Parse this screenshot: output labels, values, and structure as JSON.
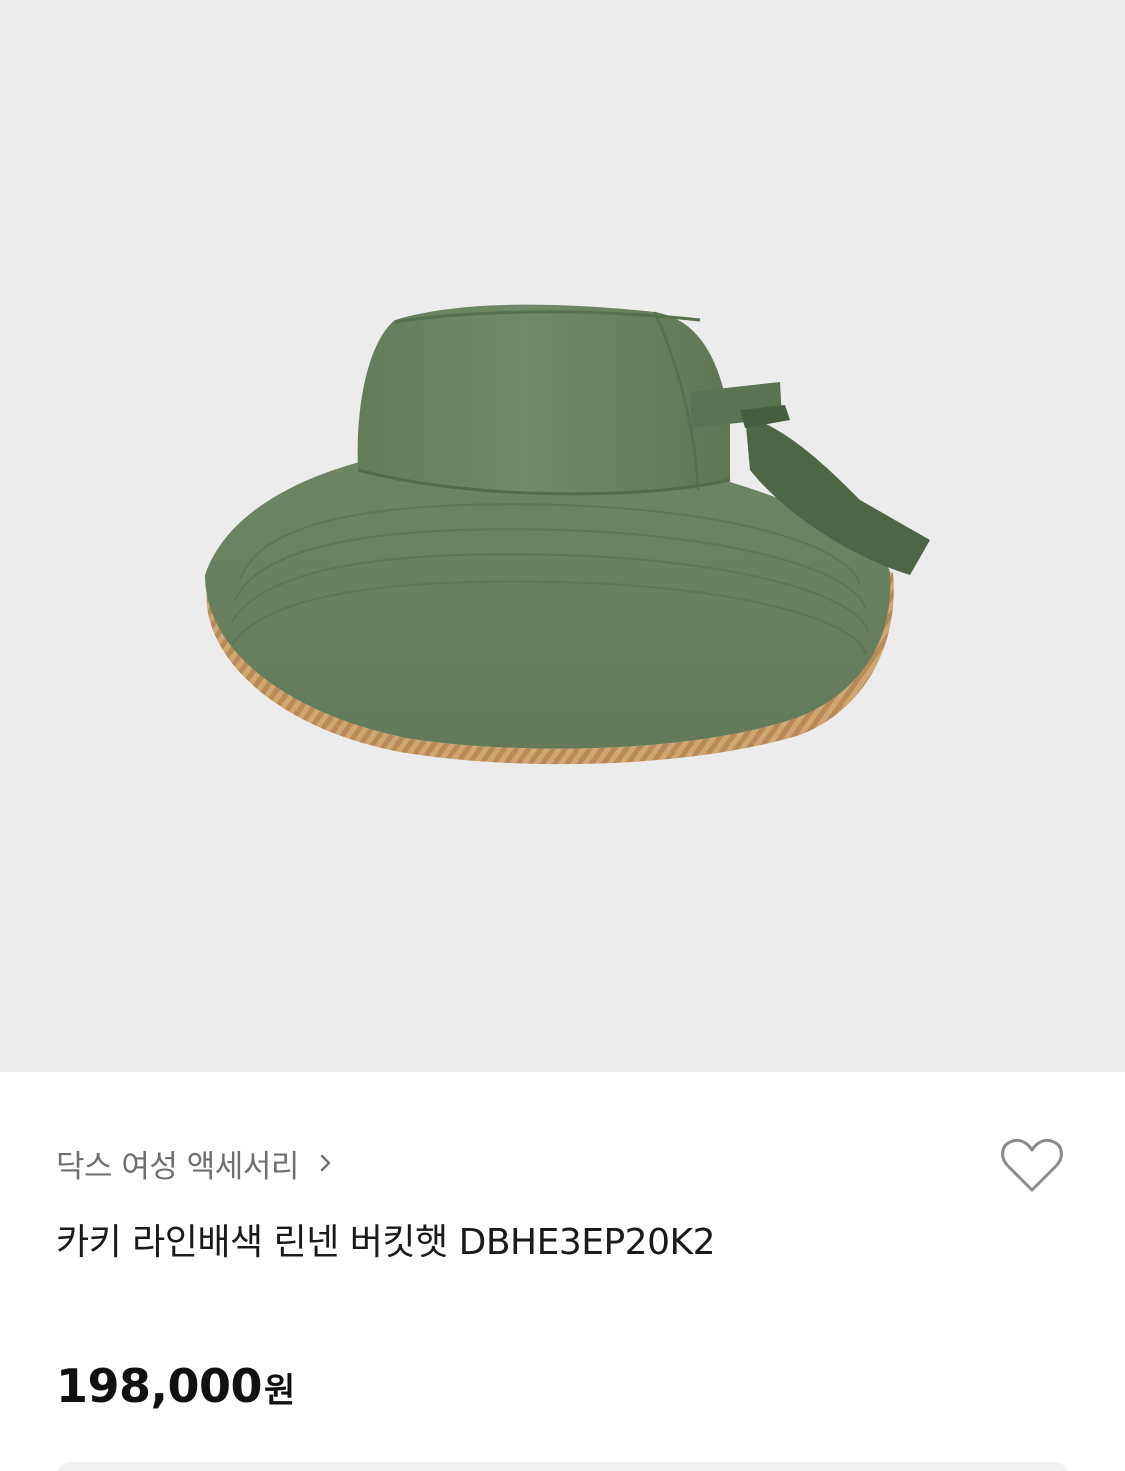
{
  "product_image": {
    "alt": "hat-image",
    "background": "#ececec"
  },
  "breadcrumb": {
    "label": "닥스 여성 액세서리",
    "chevron_icon": "chevron-right-icon"
  },
  "wishlist": {
    "icon": "heart-outline-icon"
  },
  "product": {
    "title": "카키 라인배색 린넨 버킷햇 DBHE3EP20K2",
    "price": "198,000",
    "currency": "원"
  },
  "colors": {
    "hat_green": "#6f8566",
    "straw": "#c9a06a",
    "text_muted": "#6f6f6f",
    "text_main": "#1a1a1a"
  }
}
